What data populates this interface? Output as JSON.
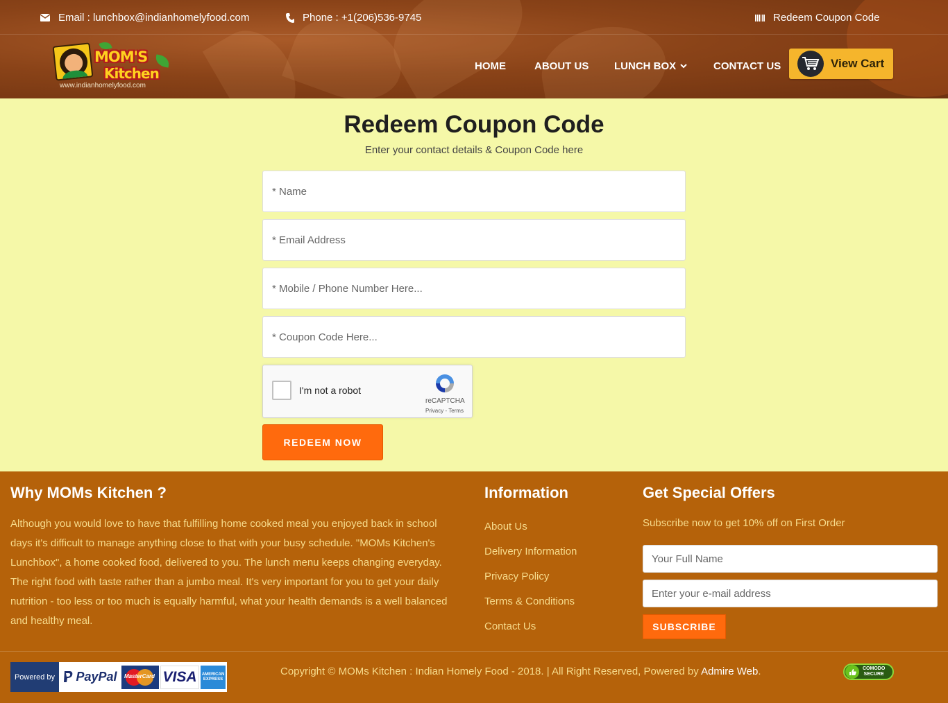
{
  "topbar": {
    "email": "Email : lunchbox@indianhomelyfood.com",
    "phone": "Phone : +1(206)536-9745",
    "redeem_link": "Redeem Coupon Code"
  },
  "logo": {
    "line1": "MOM'S",
    "line2": "Kitchen",
    "url": "www.indianhomelyfood.com"
  },
  "nav": {
    "home": "HOME",
    "about": "ABOUT US",
    "lunchbox": "LUNCH BOX",
    "contact": "CONTACT US",
    "cart": "View Cart"
  },
  "main": {
    "title": "Redeem Coupon Code",
    "subtitle": "Enter your contact details & Coupon Code here",
    "name_placeholder": "* Name",
    "email_placeholder": "* Email Address",
    "phone_placeholder": "* Mobile / Phone Number Here...",
    "coupon_placeholder": "* Coupon Code Here...",
    "captcha_label": "I'm not a robot",
    "captcha_brand": "reCAPTCHA",
    "captcha_terms": "Privacy - Terms",
    "redeem_button": "REDEEM NOW"
  },
  "footer": {
    "why_title": "Why MOMs Kitchen ?",
    "why_text": "Although you would love to have that fulfilling home cooked meal you enjoyed back in school days it's difficult to manage anything close to that with your busy schedule. \"MOMs Kitchen's Lunchbox\", a home cooked food, delivered to you. The lunch menu keeps changing everyday. The right food with taste rather than a jumbo meal. It's very important for you to get your daily nutrition - too less or too much is equally harmful, what your health demands is a well balanced and healthy meal.",
    "info_title": "Information",
    "info_links": [
      "About Us",
      "Delivery Information",
      "Privacy Policy",
      "Terms & Conditions",
      "Contact Us"
    ],
    "offers_title": "Get Special Offers",
    "offers_text": "Subscribe now to get 10% off on First Order",
    "name_placeholder": "Your Full Name",
    "email_placeholder": "Enter your e-mail address",
    "subscribe_button": "SUBSCRIBE",
    "copyright": "Copyright © MOMs Kitchen : Indian Homely Food - 2018. | All Right Reserved, Powered by ",
    "powered_by": "Admire Web",
    "copyright_end": ".",
    "payment": {
      "powered": "Powered by",
      "paypal": "PayPal",
      "mastercard": "MasterCard",
      "visa": "VISA",
      "amex": "AMERICAN EXPRESS"
    },
    "comodo": {
      "line1": "COMODO",
      "line2": "SECURE"
    }
  },
  "colors": {
    "header_bg": "#8a4318",
    "page_bg": "#f5f8a8",
    "footer_bg": "#b5620a",
    "accent_orange": "#ff6a0d",
    "cart_yellow": "#f5b52c",
    "footer_text": "#f7dc8d"
  },
  "icons": {
    "email": "envelope-icon",
    "phone": "phone-icon",
    "redeem": "barcode-icon",
    "cart": "shopping-cart-icon",
    "dropdown": "chevron-down-icon",
    "captcha": "recaptcha-icon"
  }
}
